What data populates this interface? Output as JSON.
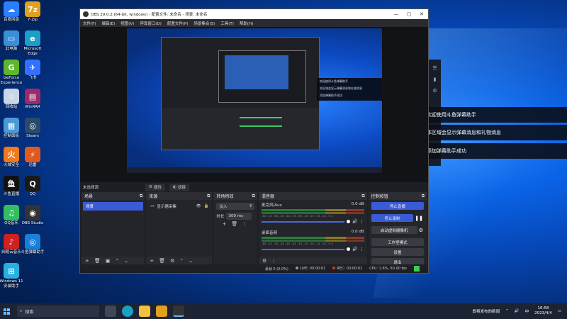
{
  "window": {
    "title": "OBS 29.0.2 (64-bit, windows) - 配置文件: 未命名 - 场景: 未命名",
    "menus": [
      "文件(F)",
      "编辑(E)",
      "视图(V)",
      "停靠窗口(D)",
      "配置文件(P)",
      "场景集合(S)",
      "工具(T)",
      "帮助(H)"
    ]
  },
  "scene_bar": {
    "label": "未选择源",
    "properties": "属性",
    "filters": "滤镜"
  },
  "docks": {
    "scenes": {
      "title": "场景",
      "items": [
        "场景"
      ]
    },
    "sources": {
      "title": "来源",
      "items": [
        "显示器采集"
      ]
    },
    "transitions": {
      "title": "转场特效",
      "selected": "淡入",
      "duration_label": "时长",
      "duration_value": "300 ms"
    },
    "mixer": {
      "title": "混音器",
      "channels": [
        {
          "name": "麦克风/Aux",
          "db": "0.0 dB"
        },
        {
          "name": "桌面音频",
          "db": "0.0 dB"
        }
      ],
      "ticks": "-60 -55 -50 -45 -40 -35 -30 -25 -20 -15 -10 -5 0"
    },
    "controls": {
      "title": "控制按钮",
      "buttons": [
        "停止直播",
        "停止录制",
        "启动虚拟摄像机",
        "工作室模式",
        "设置",
        "退出"
      ]
    }
  },
  "status": {
    "dropped": "丢帧 0 (0.0%)",
    "live": "LIVE: 00:00:01",
    "rec": "REC: 00:00:01",
    "cpu": "CPU: 1.6%, 60.00 fps"
  },
  "danmu": {
    "messages": [
      "欢迎使用斗鱼弹幕助手",
      "本区域会显示弹幕消息和礼物消息",
      "添加弹幕助手成功"
    ]
  },
  "preview_panel": [
    "欢迎使用斗鱼弹幕助手",
    "本区域会显示弹幕消息和礼物消息",
    "添加弹幕助手成功"
  ],
  "desktop_icons": [
    {
      "label": "百度网盘",
      "color": "#2b7fff",
      "glyph": "☁"
    },
    {
      "label": "7-Zip",
      "color": "#e0a020",
      "glyph": "7z"
    },
    {
      "label": "此电脑",
      "color": "#3a8fd8",
      "glyph": "▭"
    },
    {
      "label": "Microsoft Edge",
      "color": "#1aa0c8",
      "glyph": "e"
    },
    {
      "label": "GeForce Experience",
      "color": "#5cb82a",
      "glyph": "G"
    },
    {
      "label": "飞书",
      "color": "#3370ff",
      "glyph": "✈"
    },
    {
      "label": "回收站",
      "color": "#c8d6e8",
      "glyph": "♲"
    },
    {
      "label": "WinRAR",
      "color": "#9a2a6a",
      "glyph": "▤"
    },
    {
      "label": "控制面板",
      "color": "#4a9ad8",
      "glyph": "▦"
    },
    {
      "label": "Steam",
      "color": "#2a4a6a",
      "glyph": "◎"
    },
    {
      "label": "火绒安全",
      "color": "#f07a20",
      "glyph": "火"
    },
    {
      "label": "迅雷",
      "color": "#e05a20",
      "glyph": "⚡"
    },
    {
      "label": "斗鱼直播",
      "color": "#111111",
      "glyph": "鱼"
    },
    {
      "label": "QQ",
      "color": "#1a1a1a",
      "glyph": "Q"
    },
    {
      "label": "QQ音乐",
      "color": "#30c060",
      "glyph": "♫"
    },
    {
      "label": "OBS Studio",
      "color": "#333333",
      "glyph": "◉"
    },
    {
      "label": "网易云音乐",
      "color": "#d02020",
      "glyph": "♪"
    },
    {
      "label": "斗鱼弹幕助手",
      "color": "#1a7fd8",
      "glyph": "◎"
    },
    {
      "label": "Windows 11 安装助手",
      "color": "#2ab0e0",
      "glyph": "⊞"
    }
  ],
  "taskbar": {
    "search_placeholder": "搜索",
    "tray_news": "即将发布的新闻",
    "time": "16:58",
    "date": "2023/4/4"
  }
}
